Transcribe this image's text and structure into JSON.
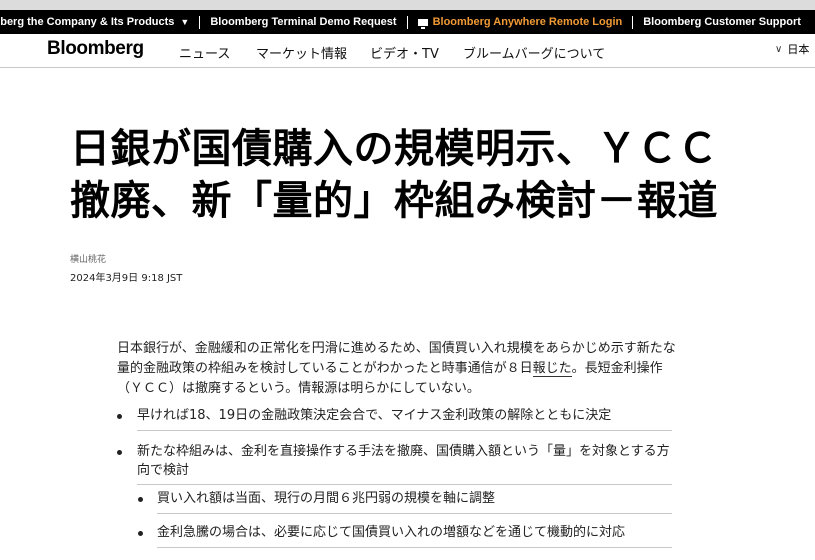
{
  "top_bar": {
    "items": [
      "Bloomberg the Company & Its Products",
      "Bloomberg Terminal Demo Request",
      "Bloomberg Anywhere Remote Login",
      "Bloomberg Customer Support"
    ],
    "caret_icon": "caret-down-icon",
    "remote_icon": "monitor-icon",
    "accent_color": "#f09a36"
  },
  "nav": {
    "logo": "Bloomberg",
    "links": [
      "ニュース",
      "マーケット情報",
      "ビデオ・TV",
      "ブルームバーグについて"
    ],
    "language": "日本",
    "language_icon": "chevron-down-icon"
  },
  "article": {
    "headline_line1": "日銀が国債購入の規模明示、ＹＣＣ",
    "headline_line2": "撤廃、新「量的」枠組み検討－報道",
    "author": "横山桃花",
    "date": "2024年3月9日 9:18 JST",
    "body": {
      "before_link": "日本銀行が、金融緩和の正常化を円滑に進めるため、国債買い入れ規模をあらかじめ示す新たな量的金融政策の枠組みを検討していることがわかったと時事通信が８日",
      "link_text": "報じた",
      "after_link": "。長短金利操作（ＹＣＣ）は撤廃するという。情報源は明らかにしていない。"
    },
    "bullets": [
      "早ければ18、19日の金融政策決定会合で、マイナス金利政策の解除とともに決定",
      "新たな枠組みは、金利を直接操作する手法を撤廃、国債購入額という「量」を対象とする方向で検討"
    ],
    "sub_bullets": [
      "買い入れ額は当面、現行の月間６兆円弱の規模を軸に調整",
      "金利急騰の場合は、必要に応じて国債買い入れの増額などを通じて機動的に対応"
    ]
  }
}
